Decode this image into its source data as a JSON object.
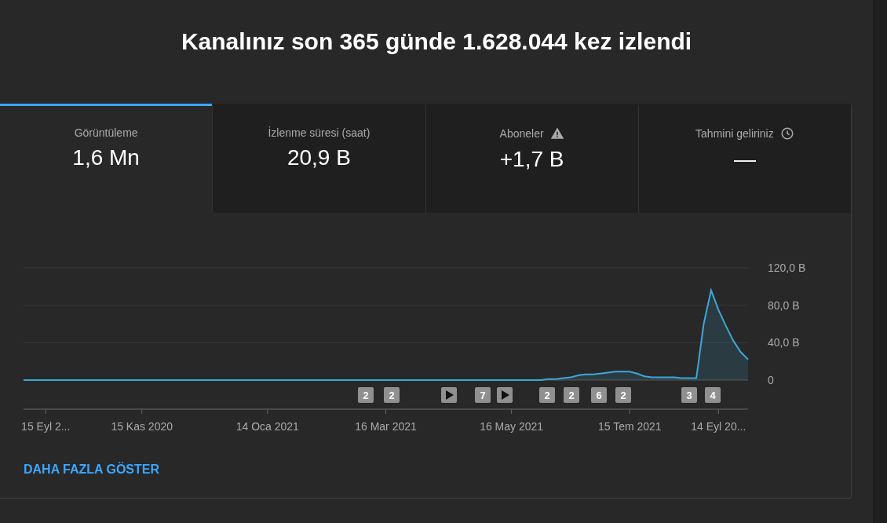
{
  "heading": "Kanalınız son 365 günde 1.628.044 kez izlendi",
  "tabs": [
    {
      "label": "Görüntüleme",
      "value": "1,6 Mn",
      "selected": true,
      "kind": "plain"
    },
    {
      "label": "İzlenme süresi (saat)",
      "value": "20,9 B",
      "selected": false,
      "kind": "plain"
    },
    {
      "label": "Aboneler",
      "value": "+1,7 B",
      "selected": false,
      "kind": "alert"
    },
    {
      "label": "Tahmini geliriniz",
      "value": "—",
      "selected": false,
      "kind": "pending"
    }
  ],
  "chart": {
    "chart_data": {
      "type": "area",
      "categories": [
        null,
        null,
        null,
        "15 Eyl 2...",
        null,
        null,
        null,
        null,
        null,
        null,
        null,
        null,
        null,
        null,
        null,
        null,
        "15 Kas 2020",
        null,
        null,
        null,
        null,
        null,
        null,
        null,
        null,
        null,
        null,
        null,
        null,
        null,
        null,
        null,
        null,
        "14 Oca 2021",
        null,
        null,
        null,
        null,
        null,
        null,
        null,
        null,
        null,
        null,
        null,
        null,
        null,
        null,
        null,
        "16 Mar 2021",
        null,
        null,
        null,
        null,
        null,
        null,
        null,
        null,
        null,
        null,
        null,
        null,
        null,
        null,
        null,
        null,
        "16 May 2021",
        null,
        null,
        null,
        null,
        null,
        null,
        null,
        null,
        null,
        null,
        null,
        null,
        null,
        null,
        null,
        "15 Tem 2021",
        null,
        null,
        null,
        null,
        null,
        null,
        null,
        null,
        null,
        null,
        null,
        "14 Eyl 20...",
        null,
        null,
        null,
        null
      ],
      "series": [
        {
          "color": "#3ea6d8",
          "values": [
            0,
            0,
            0,
            0,
            0,
            0,
            0,
            0,
            0,
            0,
            0,
            0,
            0,
            0,
            0,
            0,
            0,
            0,
            0,
            0,
            0,
            0,
            0,
            0,
            0,
            0,
            0,
            0,
            0,
            0,
            0,
            0,
            0,
            0,
            0,
            0,
            0,
            0,
            0,
            0,
            0,
            0,
            0,
            0,
            0,
            0,
            0,
            0,
            0,
            0,
            0,
            0,
            0,
            0,
            0,
            0,
            0,
            0,
            0,
            0,
            0,
            0,
            0,
            0,
            0,
            0,
            0,
            0,
            0,
            0,
            0,
            1,
            1,
            2,
            3,
            5,
            6,
            6,
            7,
            8,
            9,
            9,
            9,
            7,
            4,
            3,
            3,
            3,
            3,
            2,
            2,
            2,
            60,
            96,
            75,
            58,
            42,
            30,
            22
          ]
        }
      ],
      "ylim": [
        0,
        120
      ],
      "yticks": [
        {
          "value": 0,
          "label": "0"
        },
        {
          "value": 40,
          "label": "40,0 B"
        },
        {
          "value": 80,
          "label": "80,0 B"
        },
        {
          "value": 120,
          "label": "120,0 B"
        }
      ]
    },
    "markers": [
      {
        "kind": "count",
        "text": "2"
      },
      {
        "kind": "count",
        "text": "2"
      },
      {
        "kind": "video"
      },
      {
        "kind": "count",
        "text": "7"
      },
      {
        "kind": "video"
      },
      {
        "kind": "count",
        "text": "2"
      },
      {
        "kind": "count",
        "text": "2"
      },
      {
        "kind": "count",
        "text": "6"
      },
      {
        "kind": "count",
        "text": "2"
      },
      {
        "kind": "count",
        "text": "3"
      },
      {
        "kind": "count",
        "text": "4"
      }
    ]
  },
  "more_link": "DAHA FAZLA GÖSTER"
}
